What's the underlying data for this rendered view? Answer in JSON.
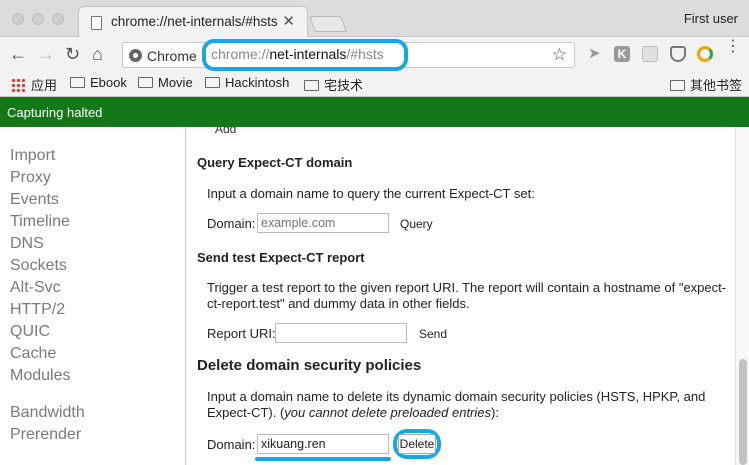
{
  "tab": {
    "title": "chrome://net-internals/#hsts",
    "close": "✕"
  },
  "profile": "First user",
  "omnibox": {
    "chip": "Chrome",
    "url_prefix": "chrome://",
    "url_host": "net-internals",
    "url_suffix": "/#hsts"
  },
  "bookmarks": [
    {
      "label": "应用",
      "icon": "apps-grid-icon"
    },
    {
      "label": "Ebook",
      "icon": "folder-icon"
    },
    {
      "label": "Movie",
      "icon": "folder-icon"
    },
    {
      "label": "Hackintosh",
      "icon": "folder-icon"
    },
    {
      "label": "宅技术",
      "icon": "folder-icon"
    },
    {
      "label": "其他书签",
      "icon": "folder-icon"
    }
  ],
  "status": "Capturing halted",
  "sidebar": {
    "items": [
      "Import",
      "Proxy",
      "Events",
      "Timeline",
      "DNS",
      "Sockets",
      "Alt-Svc",
      "HTTP/2",
      "QUIC",
      "Cache",
      "Modules"
    ],
    "items2": [
      "Bandwidth",
      "Prerender"
    ]
  },
  "main": {
    "fragment": "Add",
    "query_ct": {
      "heading": "Query Expect-CT domain",
      "desc": "Input a domain name to query the current Expect-CT set:",
      "domain_label": "Domain:",
      "placeholder": "example.com",
      "button": "Query"
    },
    "test_ct": {
      "heading": "Send test Expect-CT report",
      "desc_line1": "Trigger a test report to the given report URI. The report will contain a hostname of \"expect-",
      "desc_line2": "ct-report.test\" and dummy data in other fields.",
      "uri_label": "Report URI:",
      "button": "Send"
    },
    "delete": {
      "heading": "Delete domain security policies",
      "desc_line1": "Input a domain name to delete its dynamic domain security policies (HSTS, HPKP, and",
      "desc_line2a": "Expect-CT). (",
      "desc_line2_em": "you cannot delete preloaded entries",
      "desc_line2b": "):",
      "domain_label": "Domain:",
      "value": "xikuang.ren",
      "button": "Delete"
    }
  },
  "colors": {
    "status_bar": "#157818",
    "highlight": "#15a8e6"
  }
}
